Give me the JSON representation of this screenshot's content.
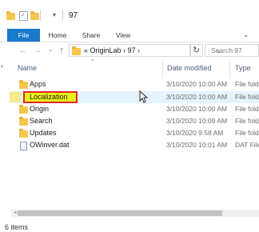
{
  "window": {
    "title": "97",
    "quick_access": [
      "folder-icon",
      "properties-icon",
      "new-folder-icon",
      "customize-icon"
    ],
    "customize_glyph": "▾"
  },
  "ribbon": {
    "tabs": [
      {
        "label": "File",
        "active": true
      },
      {
        "label": "Home"
      },
      {
        "label": "Share"
      },
      {
        "label": "View"
      }
    ],
    "expand_glyph": "⌄"
  },
  "navigation": {
    "back_glyph": "←",
    "forward_glyph": "→",
    "history_glyph": "⌄",
    "up_glyph": "↑",
    "address": "«  OriginLab  ›  97  ›",
    "address_drop_glyph": "⌄",
    "refresh_glyph": "↻",
    "search_placeholder": "Search 97"
  },
  "leftpane": {
    "scroll_glyph": "▴"
  },
  "columns": {
    "name": "Name",
    "date": "Date modified",
    "type": "Type",
    "sort_glyph": "^"
  },
  "files": [
    {
      "name": "Apps",
      "date": "3/10/2020 10:00 AM",
      "type": "File fold",
      "icon": "folder-icon"
    },
    {
      "name": "Localization",
      "date": "3/10/2020 10:00 AM",
      "type": "File fold",
      "icon": "folder-icon",
      "selected": true
    },
    {
      "name": "Origin",
      "date": "3/10/2020 10:00 AM",
      "type": "File fold",
      "icon": "folder-icon"
    },
    {
      "name": "Search",
      "date": "3/10/2020 10:09 AM",
      "type": "File fold",
      "icon": "folder-icon"
    },
    {
      "name": "Updates",
      "date": "3/10/2020 9:58 AM",
      "type": "File fold",
      "icon": "folder-icon"
    },
    {
      "name": "OWinver.dat",
      "date": "3/10/2020 10:01 AM",
      "type": "DAT File",
      "icon": "dat-file-icon"
    }
  ],
  "scrollbar": {
    "left_glyph": "◂"
  },
  "status": {
    "items_count": "6 items"
  },
  "colors": {
    "accent": "#1979ca",
    "highlight_box": "#e0282b",
    "highlight_fill": "#e9ef1a",
    "selection": "#e5f3ff",
    "folder": "#f3c64d"
  }
}
